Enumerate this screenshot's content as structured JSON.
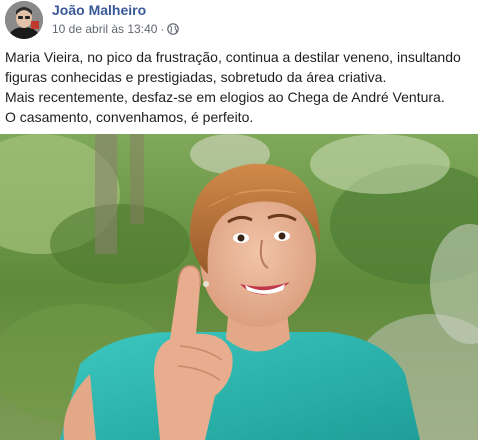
{
  "post": {
    "author": {
      "name": "João Malheiro"
    },
    "timestamp": "10 de abril às 13:40",
    "separator": "·",
    "privacy_icon": "globe-icon",
    "text_lines": [
      "Maria Vieira, no pico da frustração, continua a destilar veneno, insultando",
      "figuras conhecidas e prestigiadas, sobretudo da área criativa.",
      "Mais recentemente, desfaz-se em elogios ao Chega de André Ventura.",
      "O casamento, convenhamos, é perfeito."
    ]
  },
  "colors": {
    "author_link": "#385898",
    "meta_text": "#616770",
    "body_text": "#1c1e21",
    "photo_foliage": "#5f8a3a",
    "shirt": "#2bb7b0",
    "hair": "#b8733a"
  }
}
